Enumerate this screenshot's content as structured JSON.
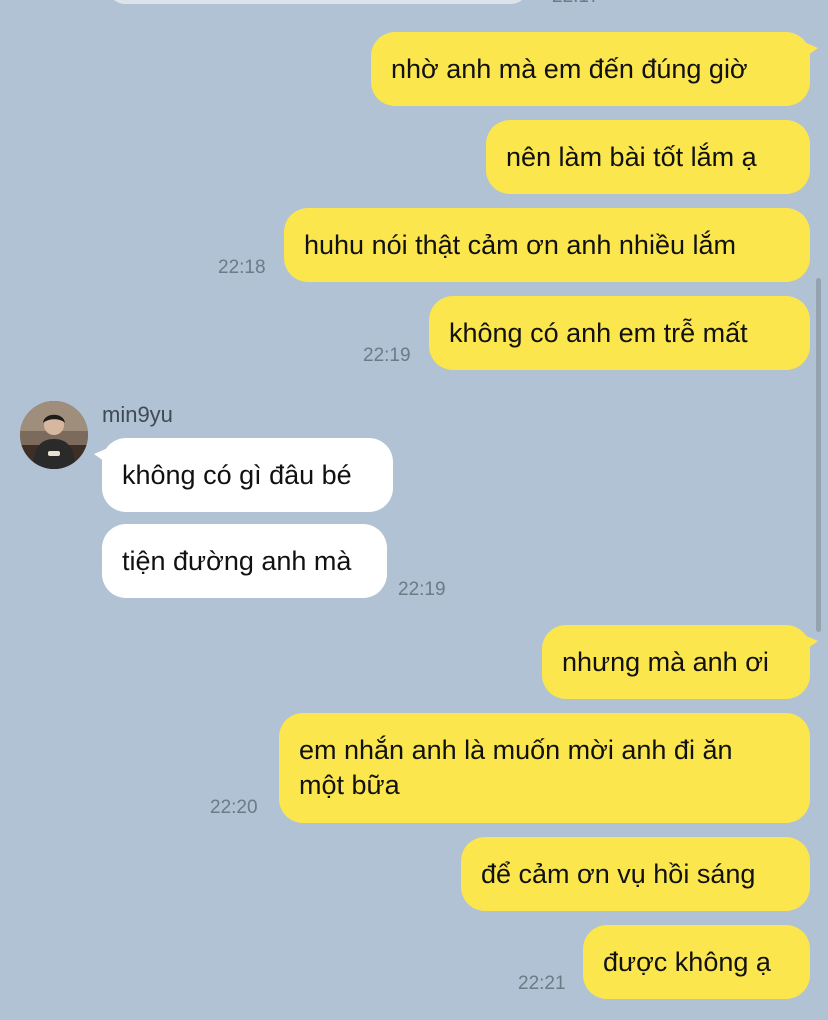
{
  "contact": {
    "name": "min9yu",
    "avatar_icon": "person-photo-icon"
  },
  "colors": {
    "background": "#b0c2d3",
    "outgoing_bubble": "#fbe64d",
    "incoming_bubble": "#ffffff"
  },
  "messages": [
    {
      "direction": "out",
      "text": "nhờ anh mà em đến đúng giờ"
    },
    {
      "direction": "out",
      "text": "nên làm bài tốt lắm ạ"
    },
    {
      "direction": "out",
      "text": "huhu nói thật cảm ơn anh nhiều lắm",
      "time": "22:18"
    },
    {
      "direction": "out",
      "text": "không có anh em trễ mất",
      "time": "22:19"
    },
    {
      "direction": "in",
      "text": "không có gì đâu bé"
    },
    {
      "direction": "in",
      "text": "tiện đường anh mà",
      "time": "22:19"
    },
    {
      "direction": "out",
      "text": "nhưng mà anh ơi"
    },
    {
      "direction": "out",
      "text": "em nhắn anh là muốn mời anh đi ăn một bữa",
      "time": "22:20"
    },
    {
      "direction": "out",
      "text": "để cảm ơn vụ hồi sáng"
    },
    {
      "direction": "out",
      "text": "được không ạ",
      "time": "22:21"
    }
  ]
}
